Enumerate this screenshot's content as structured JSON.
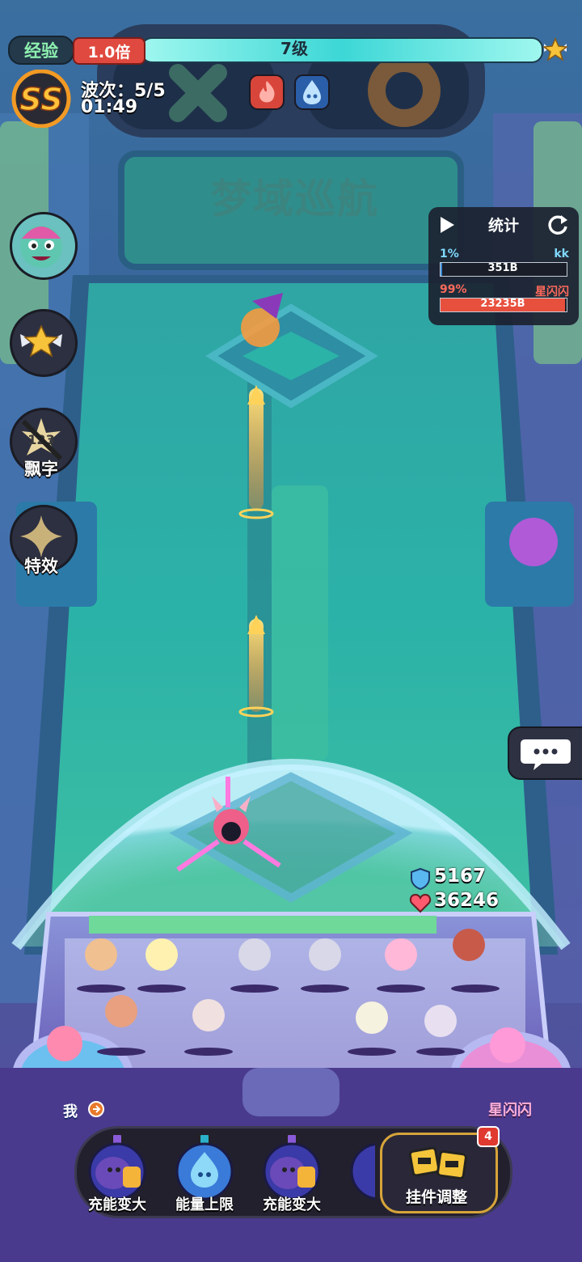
{
  "header": {
    "xp_label": "经验",
    "multiplier": "1.0倍",
    "level": "7级"
  },
  "status": {
    "rank": "SS",
    "wave": "波次：5/5",
    "timer": "01:49"
  },
  "arena": {
    "title": "梦域巡航"
  },
  "side_buttons": {
    "float_text_label": "飘字",
    "effects_label": "特效",
    "float_text_icon_text": "123"
  },
  "stats": {
    "title": "统计",
    "rows": [
      {
        "percent": "1%",
        "name": "kk",
        "value": "351B",
        "fill": 0.01,
        "color": "#3a8ad4"
      },
      {
        "percent": "99%",
        "name": "星闪闪",
        "value": "23235B",
        "fill": 0.99,
        "color": "#e8503e"
      }
    ]
  },
  "combat": {
    "shield": "5167",
    "hp": "36246"
  },
  "players": {
    "me": "我",
    "opponent": "星闪闪"
  },
  "skills": [
    {
      "label": "充能变大",
      "icon": "purple-blob-icon"
    },
    {
      "label": "能量上限",
      "icon": "blue-flask-icon"
    },
    {
      "label": "充能变大",
      "icon": "purple-blob-icon"
    }
  ],
  "idle": {
    "label": "挂件调整",
    "badge": "4"
  },
  "colors": {
    "accent_cyan": "#3cd7d6",
    "multiplier_red": "#e0493f",
    "gold": "#f6c33a"
  }
}
